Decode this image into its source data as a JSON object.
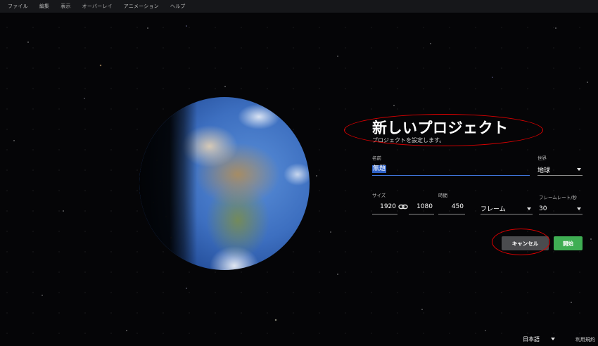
{
  "menubar": {
    "items": [
      "ファイル",
      "編集",
      "表示",
      "オーバーレイ",
      "アニメーション",
      "ヘルプ"
    ]
  },
  "dialog": {
    "title": "新しいプロジェクト",
    "subtitle": "プロジェクトを設定します。",
    "name": {
      "label": "名前",
      "value": "無題"
    },
    "world": {
      "label": "世界",
      "value": "地球"
    },
    "size": {
      "label": "サイズ",
      "width": "1920",
      "height": "1080"
    },
    "duration": {
      "label": "時間",
      "value": "450",
      "unit": "フレーム"
    },
    "framerate": {
      "label": "フレームレート/秒",
      "value": "30"
    },
    "buttons": {
      "cancel": "キャンセル",
      "start": "開始"
    }
  },
  "footer": {
    "language": "日本語",
    "terms": "利用規約"
  },
  "colors": {
    "accent_blue": "#3f74d8",
    "start_green": "#3fae53",
    "annotation_red": "#e00000"
  }
}
